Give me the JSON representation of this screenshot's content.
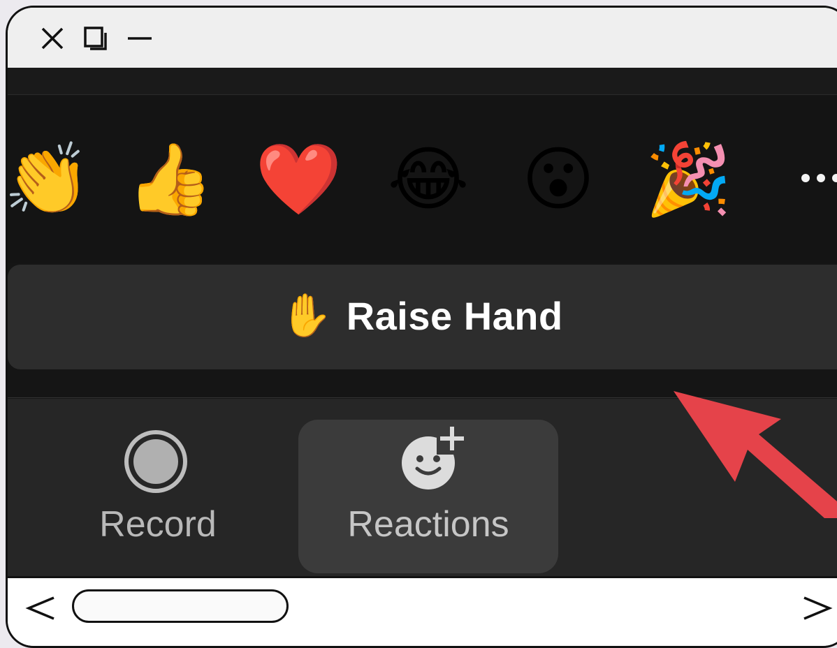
{
  "window": {
    "controls": [
      "close-icon",
      "restore-icon",
      "minimize-icon"
    ]
  },
  "reactions": {
    "emojis": [
      {
        "name": "clapping-hands",
        "glyph": "👏"
      },
      {
        "name": "thumbs-up",
        "glyph": "👍"
      },
      {
        "name": "heart",
        "glyph": "❤️"
      },
      {
        "name": "tears-of-joy",
        "glyph": "😂"
      },
      {
        "name": "open-mouth",
        "glyph": "😮"
      },
      {
        "name": "party-popper",
        "glyph": "🎉"
      }
    ],
    "more_icon": "ellipsis-icon"
  },
  "raise_hand": {
    "glyph": "✋",
    "label": "Raise Hand"
  },
  "toolbar": {
    "record_label": "Record",
    "reactions_label": "Reactions"
  },
  "scrollbar": {
    "left_arrow": "<",
    "right_arrow": ">"
  },
  "colors": {
    "annotation_arrow": "#e5434a",
    "panel_bg": "#151515",
    "raise_bg": "#2d2d2d",
    "toolbar_bg": "#262626",
    "reactions_selected_bg": "#3b3b3b"
  }
}
